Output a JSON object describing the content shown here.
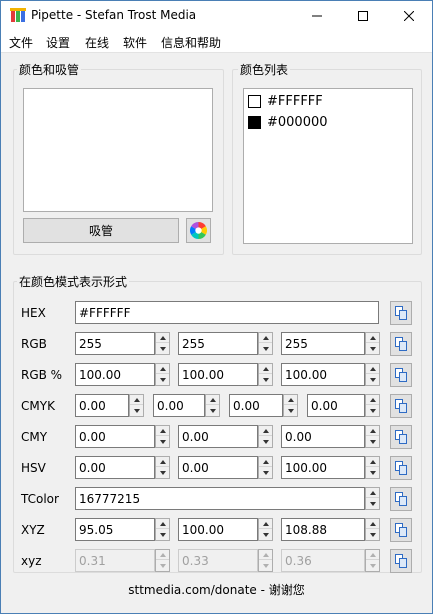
{
  "window": {
    "title": "Pipette - Stefan Trost Media"
  },
  "menu": [
    "文件",
    "设置",
    "在线",
    "软件",
    "信息和帮助"
  ],
  "picker_group": {
    "label": "颜色和吸管",
    "preview_color": "#FFFFFF",
    "pick_button": "吸管",
    "wheel_icon": "color-wheel-icon"
  },
  "list_group": {
    "label": "颜色列表",
    "colors": [
      {
        "hex": "#FFFFFF",
        "swatch": "#FFFFFF"
      },
      {
        "hex": "#000000",
        "swatch": "#000000"
      }
    ]
  },
  "modes_group": {
    "label": "在颜色模式表示形式",
    "rows": [
      {
        "label": "HEX",
        "values": [
          "#FFFFFF"
        ]
      },
      {
        "label": "RGB",
        "values": [
          "255",
          "255",
          "255"
        ]
      },
      {
        "label": "RGB %",
        "values": [
          "100.00",
          "100.00",
          "100.00"
        ]
      },
      {
        "label": "CMYK",
        "values": [
          "0.00",
          "0.00",
          "0.00",
          "0.00"
        ]
      },
      {
        "label": "CMY",
        "values": [
          "0.00",
          "0.00",
          "0.00"
        ]
      },
      {
        "label": "HSV",
        "values": [
          "0.00",
          "0.00",
          "100.00"
        ]
      },
      {
        "label": "TColor",
        "values": [
          "16777215"
        ]
      },
      {
        "label": "XYZ",
        "values": [
          "95.05",
          "100.00",
          "108.88"
        ]
      },
      {
        "label": "xyz",
        "values": [
          "0.31",
          "0.33",
          "0.36"
        ],
        "disabled": true
      }
    ]
  },
  "footer": "sttmedia.com/donate - 谢谢您"
}
